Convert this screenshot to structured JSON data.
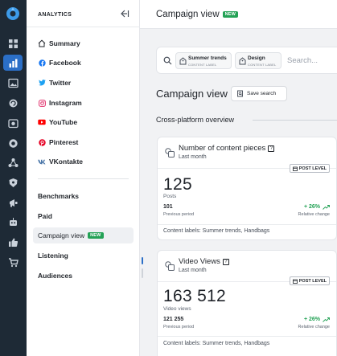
{
  "sidebar": {
    "header": "ANALYTICS",
    "networks": [
      {
        "label": "Summary",
        "icon": "home-icon"
      },
      {
        "label": "Facebook",
        "icon": "facebook-icon",
        "color": "#1877f2"
      },
      {
        "label": "Twitter",
        "icon": "twitter-icon",
        "color": "#1da1f2"
      },
      {
        "label": "Instagram",
        "icon": "instagram-icon",
        "color": "#e1306c"
      },
      {
        "label": "YouTube",
        "icon": "youtube-icon",
        "color": "#ff0000"
      },
      {
        "label": "Pinterest",
        "icon": "pinterest-icon",
        "color": "#e60023"
      },
      {
        "label": "VKontakte",
        "icon": "vk-icon",
        "color": "#4a76a8"
      }
    ],
    "sections": [
      {
        "label": "Benchmarks"
      },
      {
        "label": "Paid"
      },
      {
        "label": "Campaign view",
        "badge": "NEW",
        "selected": true
      },
      {
        "label": "Listening"
      },
      {
        "label": "Audiences"
      }
    ]
  },
  "header": {
    "title": "Campaign view",
    "badge": "NEW"
  },
  "search": {
    "chips": [
      {
        "label": "Summer trends",
        "sublabel": "CONTENT LABEL"
      },
      {
        "label": "Design",
        "sublabel": "CONTENT LABEL"
      }
    ],
    "placeholder": "Search..."
  },
  "main": {
    "title": "Campaign view",
    "save_button": "Save search",
    "overview_title": "Cross-platform overview"
  },
  "cards": [
    {
      "title": "Number of content pieces",
      "subtitle": "Last month",
      "level": "POST LEVEL",
      "value": "125",
      "unit": "Posts",
      "previous_value": "101",
      "previous_label": "Previous period",
      "change": "+ 26%",
      "change_label": "Relative change",
      "labels": "Content labels: Summer trends, Handbags"
    },
    {
      "title": "Video Views",
      "subtitle": "Last month",
      "level": "POST LEVEL",
      "value": "163 512",
      "unit": "Video views",
      "previous_value": "121 255",
      "previous_label": "Previous period",
      "change": "+ 26%",
      "change_label": "Relative change",
      "labels": "Content labels: Summer trends, Handbags"
    }
  ],
  "colors": {
    "accent": "#2b6fc7",
    "new_badge": "#24a256",
    "positive": "#24a256",
    "rail": "#1e2a36"
  }
}
